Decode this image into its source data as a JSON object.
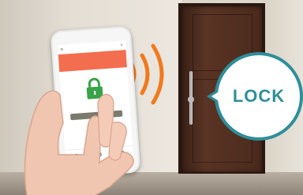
{
  "scene": {
    "description_colors": {
      "door": "#4a2a1d",
      "accent_teal": "#2f8e9a",
      "wave_orange": "#f07a1e",
      "banner_orange": "#f36d4f",
      "lock_green": "#3aa24a"
    }
  },
  "bubble": {
    "label": "LOCK"
  },
  "icons": {
    "signal": "signal-waves-icon",
    "lock": "padlock-icon"
  }
}
